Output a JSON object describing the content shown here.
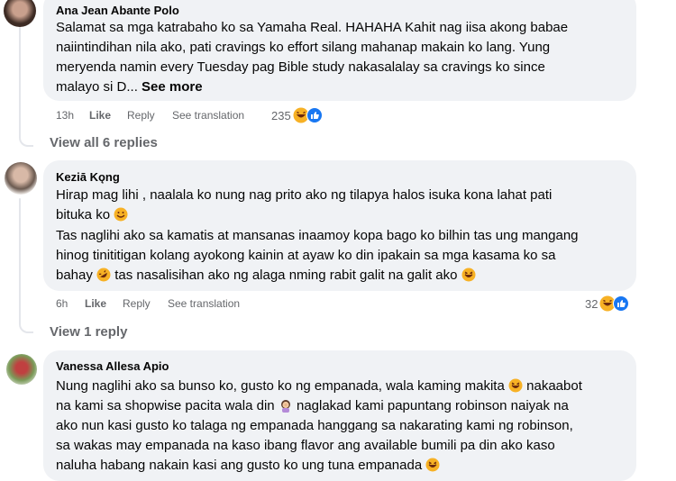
{
  "comments": [
    {
      "author": "Ana Jean Abante Polo",
      "lines": [
        "Salamat sa mga katrabaho ko sa Yamaha Real. HAHAHA Kahit nag iisa akong babae",
        "naiintindihan nila ako, pati cravings ko effort silang mahanap makain ko lang. Yung",
        "meryenda namin every Tuesday pag Bible study nakasalalay sa cravings ko since",
        "malayo si D..."
      ],
      "see_more": "See more",
      "time": "13h",
      "like": "Like",
      "reply": "Reply",
      "translate": "See translation",
      "reaction_count": "235"
    },
    {
      "author": "Keziā Kǫng",
      "lines": [
        "Hirap mag lihi , naalala ko nung nag prito ako ng tilapya halos isuka kona lahat pati",
        "bituka ko",
        "Tas naglihi ako sa kamatis at mansanas inaamoy kopa bago ko bilhin tas ung mangang",
        "hinog tinititigan kolang ayokong kainin at ayaw ko din ipakain sa mga kasama ko sa",
        "bahay",
        "tas nasalisihan ako ng alaga nming rabit galit na galit ako"
      ],
      "time": "6h",
      "like": "Like",
      "reply": "Reply",
      "translate": "See translation",
      "reaction_count": "32"
    },
    {
      "author": "Vanessa Allesa Apio",
      "lines": [
        "Nung naglihi ako sa bunso ko, gusto ko ng empanada, wala kaming makita",
        "nakaabot",
        "na kami sa shopwise pacita wala din",
        "naglakad kami papuntang robinson naiyak na",
        "ako nun kasi gusto ko talaga ng empanada hanggang sa nakarating kami ng robinson,",
        "sa wakas may empanada na kaso ibang flavor ang available bumili pa din ako kaso",
        "naluha habang nakain kasi ang gusto ko ung tuna empanada"
      ]
    }
  ],
  "view_all_replies": "View all 6 replies",
  "view_one_reply": "View 1 reply",
  "colors": {
    "bubble": "#f0f2f5",
    "muted": "#65676b",
    "like_blue": "#1877f2",
    "haha_yellow": "#f7b125"
  },
  "icons": [
    "haha-emoji-icon",
    "like-reaction-icon",
    "smiling-emoji-icon",
    "rofl-emoji-icon",
    "laughing-emoji-icon",
    "woman-facepalming-emoji-icon"
  ]
}
